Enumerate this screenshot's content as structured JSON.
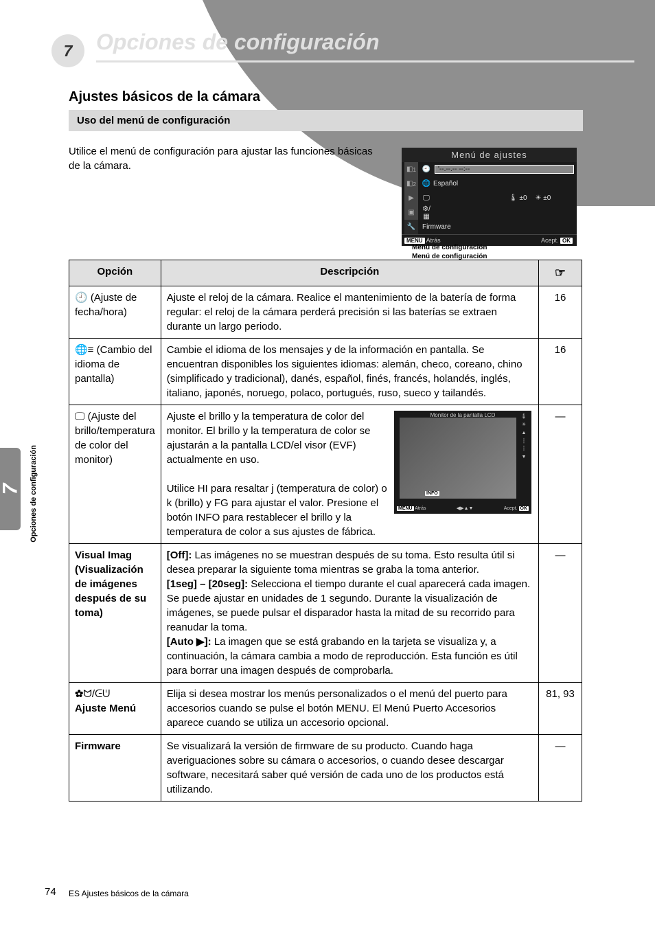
{
  "page_number": "7",
  "chapter_title": "Opciones de configuración",
  "chapter_subtitle": "Ajustes básicos de la cámara",
  "section_title": "Uso del menú de configuración",
  "section_body": "Utilice el menú de configuración para ajustar las funciones básicas de la cámara.",
  "menu_sim": {
    "title": "Menú de ajustes",
    "row1": {
      "label": "'--.--.-- --:--"
    },
    "row2": {
      "label": "Español"
    },
    "row3": {
      "left_sym": "j",
      "right_sym": "±0",
      "right_sym2": "k",
      "right_sym3": "±0"
    },
    "row4": {
      "label": ""
    },
    "row5": {
      "label": "Firmware"
    },
    "footer_left": "Atrás",
    "footer_right": "Acept.",
    "footer_left_tag": "MENU",
    "footer_right_tag": "OK"
  },
  "menu_headline1": "Menú de configuración",
  "menu_headline2": "Menú de configuración",
  "table": {
    "head1": "Opción",
    "head2": "Descripción",
    "head3_sym": "☞",
    "rows": [
      {
        "c1_sym": "🕘",
        "c1_text": "(Ajuste de fecha/hora)",
        "c2": "Ajuste el reloj de la cámara. Realice el mantenimiento de la batería de forma regular: el reloj de la cámara perderá precisión si las baterías se extraen durante un largo periodo.",
        "c3": "16"
      },
      {
        "c1_sym": "🌐≡",
        "c1_text": "(Cambio del idioma de pantalla)",
        "c2": "Cambie el idioma de los mensajes y de la información en pantalla. Se encuentran disponibles los siguientes idiomas: alemán, checo, coreano, chino (simplificado y tradicional), danés, español, finés, francés, holandés, inglés, italiano, japonés, noruego, polaco, portugués, ruso, sueco y tailandés.",
        "c3": "16"
      },
      {
        "c1_sym": "🖵",
        "c1_text": "(Ajuste del brillo/temperatura de color del monitor)",
        "c2_p1": "Ajuste el brillo y la temperatura de color del monitor. El brillo y la temperatura de color se ajustarán a la pantalla LCD/el visor (EVF) actualmente en uso.",
        "c2_p2": "Utilice HI para resaltar j (temperatura de color) o k (brillo) y FG para ajustar el valor. Presione el botón INFO para restablecer el brillo y la temperatura de color a sus ajustes de fábrica.",
        "c3": "—",
        "preview": {
          "title": "Monitor de la pantalla LCD",
          "side_j": "j",
          "side_k": "k",
          "info_tag": "INFO",
          "bottom_left_tag": "MENU",
          "bottom_left": "Atrás",
          "bottom_arrows": "◀▶▲▼",
          "bottom_right_tag": "OK",
          "bottom_right": "Acept."
        }
      },
      {
        "c1_title": "Visual Imag (Visualización de imágenes después de su toma)",
        "c2_label_off": "[Off]:",
        "c2_off": "Las imágenes no se muestran después de su toma. Esto resulta útil si desea preparar la siguiente toma mientras se graba la toma anterior.",
        "c2_label_on": "[1seg] – [20seg]:",
        "c2_on": "Selecciona el tiempo durante el cual aparecerá cada imagen. Se puede ajustar en unidades de 1 segundo. Durante la visualización de imágenes, se puede pulsar el disparador hasta la mitad de su recorrido para reanudar la toma.",
        "c2_label_auto": "[Auto ▶]:",
        "c2_auto": "La imagen que se está grabando en la tarjeta se visualiza y, a continuación, la cámara cambia a modo de reproducción. Esta función es útil para borrar una imagen después de comprobarla.",
        "c3": "—"
      },
      {
        "c1_sym": "✿ᗢ/ᕮᕫ",
        "c1_text": "Ajuste Menú",
        "c2": "Elija si desea mostrar los menús personalizados o el menú del puerto para accesorios cuando se pulse el botón MENU. El Menú Puerto Accesorios aparece cuando se utiliza un accesorio opcional.",
        "c3": "81, 93"
      },
      {
        "c1_title": "Firmware",
        "c2": "Se visualizará la versión de firmware de su producto. Cuando haga averiguaciones sobre su cámara o accesorios, o cuando desee descargar software, necesitará saber qué versión de cada uno de los productos está utilizando.",
        "c3": "—"
      }
    ]
  },
  "side_tab": "7",
  "side_label": "Opciones de configuración",
  "footer_page": "74",
  "footer_title": "ES   Ajustes básicos de la cámara"
}
